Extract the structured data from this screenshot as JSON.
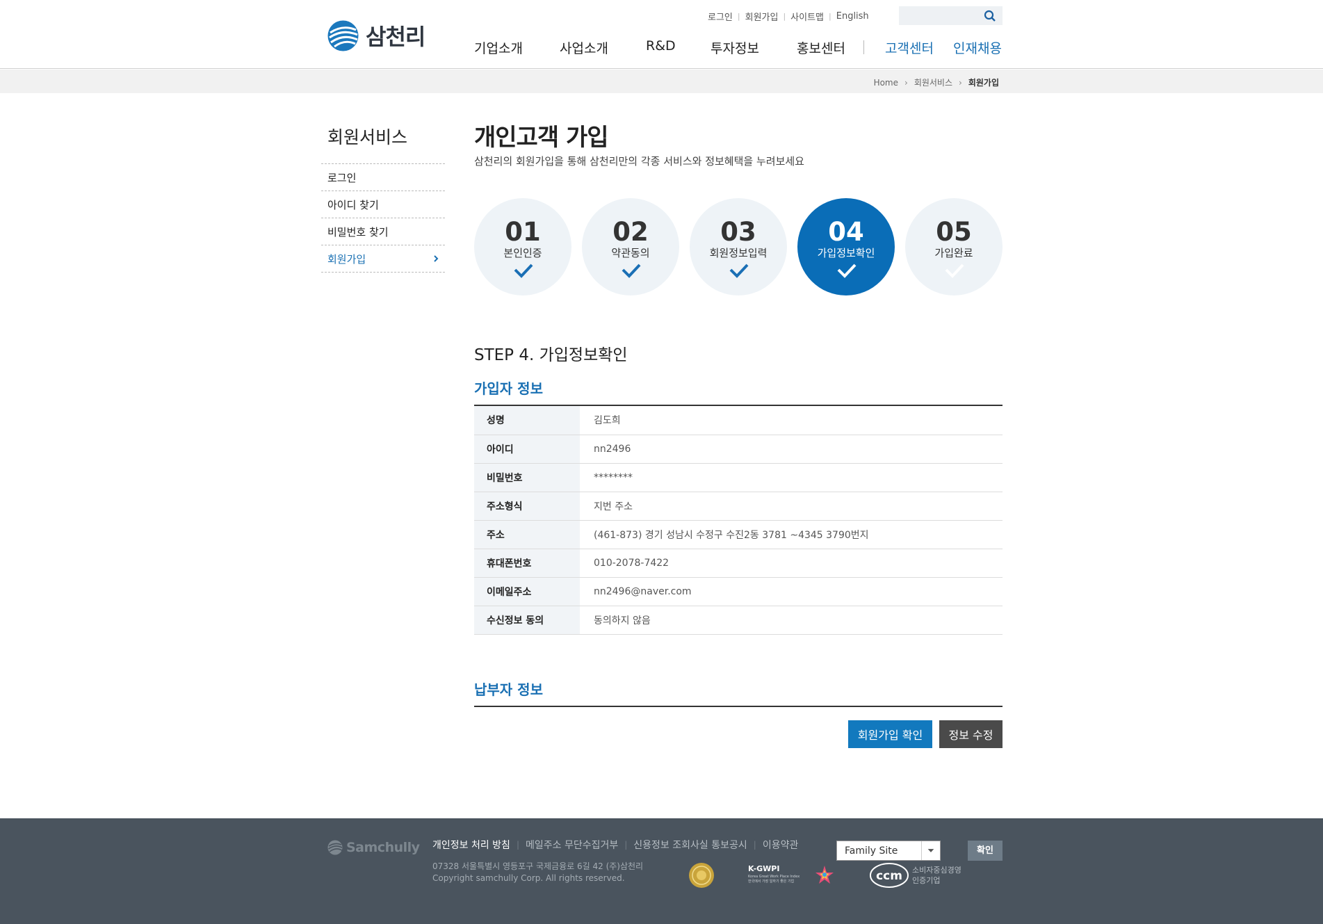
{
  "header": {
    "logo_text": "삼천리",
    "util_links": [
      "로그인",
      "회원가입",
      "사이트맵",
      "English"
    ],
    "search_placeholder": "",
    "gnb": [
      "기업소개",
      "사업소개",
      "R&D",
      "투자정보",
      "홍보센터",
      "고객센터",
      "인재채용"
    ]
  },
  "breadcrumb": [
    "Home",
    "회원서비스",
    "회원가입"
  ],
  "sidebar": {
    "title": "회원서비스",
    "items": [
      "로그인",
      "아이디 찾기",
      "비밀번호 찾기",
      "회원가입"
    ],
    "active_index": 3
  },
  "page": {
    "title": "개인고객 가입",
    "desc": "삼천리의 회원가입을 통해 삼천리만의 각종 서비스와 정보혜택을 누려보세요"
  },
  "steps": [
    {
      "num": "01",
      "label": "본인인증",
      "state": "done"
    },
    {
      "num": "02",
      "label": "약관동의",
      "state": "done"
    },
    {
      "num": "03",
      "label": "회원정보입력",
      "state": "done"
    },
    {
      "num": "04",
      "label": "가입정보확인",
      "state": "active"
    },
    {
      "num": "05",
      "label": "가입완료",
      "state": "todo"
    }
  ],
  "step_heading": "STEP 4. 가입정보확인",
  "member_section": {
    "title": "가입자 정보",
    "rows": [
      {
        "label": "성명",
        "value": "김도희"
      },
      {
        "label": "아이디",
        "value": "nn2496"
      },
      {
        "label": "비밀번호",
        "value": "********"
      },
      {
        "label": "주소형식",
        "value": "지번 주소"
      },
      {
        "label": "주소",
        "value": "(461-873) 경기 성남시 수정구 수진2동 3781 ~4345 3790번지"
      },
      {
        "label": "휴대폰번호",
        "value": "010-2078-7422"
      },
      {
        "label": "이메일주소",
        "value": "nn2496@naver.com"
      },
      {
        "label": "수신정보 동의",
        "value": "동의하지 않음"
      }
    ]
  },
  "payer_section": {
    "title": "납부자 정보"
  },
  "buttons": {
    "confirm": "회원가입 확인",
    "edit": "정보 수정"
  },
  "footer": {
    "logo_text": "Samchully",
    "links": [
      "개인정보 처리 방침",
      "메일주소 무단수집거부",
      "신용정보 조회사실 통보공시",
      "이용약관"
    ],
    "address": "07328 서울특별시 영등포구 국제금융로 6길 42 (주)삼천리",
    "copyright": "Copyright samchully Corp. All rights reserved.",
    "badge_kgwpi": "K-GWPI",
    "badge_kgwpi_sub": "Korea Great Work Place Index",
    "badge_kgwpi_sub2": "한국에서 가장 일하기 좋은 기업",
    "badge_ccm": "ccm",
    "badge_ccm_text1": "소비자중심경영",
    "badge_ccm_text2": "인증기업",
    "family_site": "Family Site",
    "family_btn": "확인"
  },
  "colors": {
    "accent": "#1a70b3",
    "active_step": "#0a6db7",
    "footer_bg": "#4a545e",
    "edit_btn": "#4a4a4a"
  }
}
